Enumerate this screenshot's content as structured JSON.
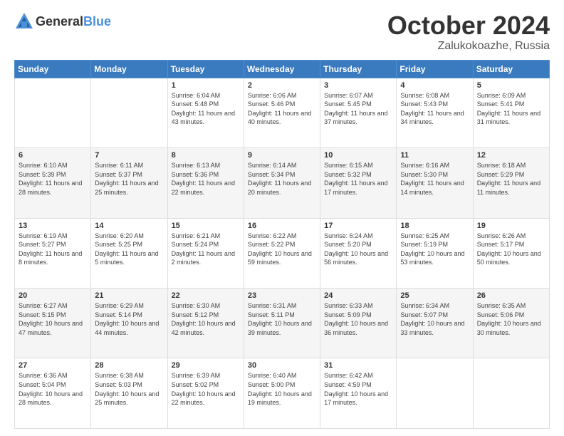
{
  "header": {
    "logo_general": "General",
    "logo_blue": "Blue",
    "month": "October 2024",
    "location": "Zalukokoazhe, Russia"
  },
  "days_of_week": [
    "Sunday",
    "Monday",
    "Tuesday",
    "Wednesday",
    "Thursday",
    "Friday",
    "Saturday"
  ],
  "weeks": [
    [
      {
        "day": "",
        "info": ""
      },
      {
        "day": "",
        "info": ""
      },
      {
        "day": "1",
        "info": "Sunrise: 6:04 AM\nSunset: 5:48 PM\nDaylight: 11 hours and 43 minutes."
      },
      {
        "day": "2",
        "info": "Sunrise: 6:06 AM\nSunset: 5:46 PM\nDaylight: 11 hours and 40 minutes."
      },
      {
        "day": "3",
        "info": "Sunrise: 6:07 AM\nSunset: 5:45 PM\nDaylight: 11 hours and 37 minutes."
      },
      {
        "day": "4",
        "info": "Sunrise: 6:08 AM\nSunset: 5:43 PM\nDaylight: 11 hours and 34 minutes."
      },
      {
        "day": "5",
        "info": "Sunrise: 6:09 AM\nSunset: 5:41 PM\nDaylight: 11 hours and 31 minutes."
      }
    ],
    [
      {
        "day": "6",
        "info": "Sunrise: 6:10 AM\nSunset: 5:39 PM\nDaylight: 11 hours and 28 minutes."
      },
      {
        "day": "7",
        "info": "Sunrise: 6:11 AM\nSunset: 5:37 PM\nDaylight: 11 hours and 25 minutes."
      },
      {
        "day": "8",
        "info": "Sunrise: 6:13 AM\nSunset: 5:36 PM\nDaylight: 11 hours and 22 minutes."
      },
      {
        "day": "9",
        "info": "Sunrise: 6:14 AM\nSunset: 5:34 PM\nDaylight: 11 hours and 20 minutes."
      },
      {
        "day": "10",
        "info": "Sunrise: 6:15 AM\nSunset: 5:32 PM\nDaylight: 11 hours and 17 minutes."
      },
      {
        "day": "11",
        "info": "Sunrise: 6:16 AM\nSunset: 5:30 PM\nDaylight: 11 hours and 14 minutes."
      },
      {
        "day": "12",
        "info": "Sunrise: 6:18 AM\nSunset: 5:29 PM\nDaylight: 11 hours and 11 minutes."
      }
    ],
    [
      {
        "day": "13",
        "info": "Sunrise: 6:19 AM\nSunset: 5:27 PM\nDaylight: 11 hours and 8 minutes."
      },
      {
        "day": "14",
        "info": "Sunrise: 6:20 AM\nSunset: 5:25 PM\nDaylight: 11 hours and 5 minutes."
      },
      {
        "day": "15",
        "info": "Sunrise: 6:21 AM\nSunset: 5:24 PM\nDaylight: 11 hours and 2 minutes."
      },
      {
        "day": "16",
        "info": "Sunrise: 6:22 AM\nSunset: 5:22 PM\nDaylight: 10 hours and 59 minutes."
      },
      {
        "day": "17",
        "info": "Sunrise: 6:24 AM\nSunset: 5:20 PM\nDaylight: 10 hours and 56 minutes."
      },
      {
        "day": "18",
        "info": "Sunrise: 6:25 AM\nSunset: 5:19 PM\nDaylight: 10 hours and 53 minutes."
      },
      {
        "day": "19",
        "info": "Sunrise: 6:26 AM\nSunset: 5:17 PM\nDaylight: 10 hours and 50 minutes."
      }
    ],
    [
      {
        "day": "20",
        "info": "Sunrise: 6:27 AM\nSunset: 5:15 PM\nDaylight: 10 hours and 47 minutes."
      },
      {
        "day": "21",
        "info": "Sunrise: 6:29 AM\nSunset: 5:14 PM\nDaylight: 10 hours and 44 minutes."
      },
      {
        "day": "22",
        "info": "Sunrise: 6:30 AM\nSunset: 5:12 PM\nDaylight: 10 hours and 42 minutes."
      },
      {
        "day": "23",
        "info": "Sunrise: 6:31 AM\nSunset: 5:11 PM\nDaylight: 10 hours and 39 minutes."
      },
      {
        "day": "24",
        "info": "Sunrise: 6:33 AM\nSunset: 5:09 PM\nDaylight: 10 hours and 36 minutes."
      },
      {
        "day": "25",
        "info": "Sunrise: 6:34 AM\nSunset: 5:07 PM\nDaylight: 10 hours and 33 minutes."
      },
      {
        "day": "26",
        "info": "Sunrise: 6:35 AM\nSunset: 5:06 PM\nDaylight: 10 hours and 30 minutes."
      }
    ],
    [
      {
        "day": "27",
        "info": "Sunrise: 6:36 AM\nSunset: 5:04 PM\nDaylight: 10 hours and 28 minutes."
      },
      {
        "day": "28",
        "info": "Sunrise: 6:38 AM\nSunset: 5:03 PM\nDaylight: 10 hours and 25 minutes."
      },
      {
        "day": "29",
        "info": "Sunrise: 6:39 AM\nSunset: 5:02 PM\nDaylight: 10 hours and 22 minutes."
      },
      {
        "day": "30",
        "info": "Sunrise: 6:40 AM\nSunset: 5:00 PM\nDaylight: 10 hours and 19 minutes."
      },
      {
        "day": "31",
        "info": "Sunrise: 6:42 AM\nSunset: 4:59 PM\nDaylight: 10 hours and 17 minutes."
      },
      {
        "day": "",
        "info": ""
      },
      {
        "day": "",
        "info": ""
      }
    ]
  ]
}
